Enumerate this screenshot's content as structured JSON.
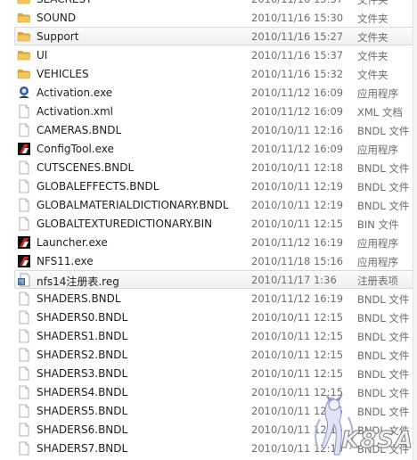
{
  "colors": {
    "folder": "#e8b84a",
    "selection": "#f0f0f0",
    "text": "#1e1e1e",
    "subtle_text": "#6d6d6d",
    "nfs_icon_red": "#d42020"
  },
  "files": [
    {
      "name": "SEACREST",
      "date": "2010/11/16 15:37",
      "type": "文件夹",
      "icon": "folder-icon"
    },
    {
      "name": "SOUND",
      "date": "2010/11/16 15:30",
      "type": "文件夹",
      "icon": "folder-icon"
    },
    {
      "name": "Support",
      "date": "2010/11/16 15:27",
      "type": "文件夹",
      "icon": "folder-icon",
      "selected": true
    },
    {
      "name": "UI",
      "date": "2010/11/16 15:37",
      "type": "文件夹",
      "icon": "folder-icon"
    },
    {
      "name": "VEHICLES",
      "date": "2010/11/16 15:32",
      "type": "文件夹",
      "icon": "folder-icon"
    },
    {
      "name": "Activation.exe",
      "date": "2010/11/12 16:09",
      "type": "应用程序",
      "icon": "activation-exe-icon"
    },
    {
      "name": "Activation.xml",
      "date": "2010/11/12 16:09",
      "type": "XML 文档",
      "icon": "document-icon"
    },
    {
      "name": "CAMERAS.BNDL",
      "date": "2010/10/11 12:16",
      "type": "BNDL 文件",
      "icon": "document-icon"
    },
    {
      "name": "ConfigTool.exe",
      "date": "2010/11/12 16:09",
      "type": "应用程序",
      "icon": "nfs-exe-icon"
    },
    {
      "name": "CUTSCENES.BNDL",
      "date": "2010/10/11 12:18",
      "type": "BNDL 文件",
      "icon": "document-icon"
    },
    {
      "name": "GLOBALEFFECTS.BNDL",
      "date": "2010/10/11 12:19",
      "type": "BNDL 文件",
      "icon": "document-icon"
    },
    {
      "name": "GLOBALMATERIALDICTIONARY.BNDL",
      "date": "2010/10/11 12:19",
      "type": "BNDL 文件",
      "icon": "document-icon"
    },
    {
      "name": "GLOBALTEXTUREDICTIONARY.BIN",
      "date": "2010/10/11 12:15",
      "type": "BIN 文件",
      "icon": "document-icon"
    },
    {
      "name": "Launcher.exe",
      "date": "2010/11/12 16:19",
      "type": "应用程序",
      "icon": "nfs-exe-icon"
    },
    {
      "name": "NFS11.exe",
      "date": "2010/11/18 15:16",
      "type": "应用程序",
      "icon": "nfs-exe-icon"
    },
    {
      "name": "nfs14注册表.reg",
      "date": "2010/11/17 1:36",
      "type": "注册表项",
      "icon": "registry-file-icon",
      "selected": true
    },
    {
      "name": "SHADERS.BNDL",
      "date": "2010/11/12 16:19",
      "type": "BNDL 文件",
      "icon": "document-icon"
    },
    {
      "name": "SHADERS0.BNDL",
      "date": "2010/10/11 12:15",
      "type": "BNDL 文件",
      "icon": "document-icon"
    },
    {
      "name": "SHADERS1.BNDL",
      "date": "2010/10/11 12:15",
      "type": "BNDL 文件",
      "icon": "document-icon"
    },
    {
      "name": "SHADERS2.BNDL",
      "date": "2010/10/11 12:15",
      "type": "BNDL 文件",
      "icon": "document-icon"
    },
    {
      "name": "SHADERS3.BNDL",
      "date": "2010/10/11 12:15",
      "type": "BNDL 文件",
      "icon": "document-icon"
    },
    {
      "name": "SHADERS4.BNDL",
      "date": "2010/10/11 12:15",
      "type": "BNDL 文件",
      "icon": "document-icon"
    },
    {
      "name": "SHADERS5.BNDL",
      "date": "2010/10/11 12:15",
      "type": "BNDL 文件",
      "icon": "document-icon"
    },
    {
      "name": "SHADERS6.BNDL",
      "date": "2010/10/11 12:15",
      "type": "BNDL 文件",
      "icon": "document-icon"
    },
    {
      "name": "SHADERS7.BNDL",
      "date": "2010/10/11 12:15",
      "type": "BNDL 文件",
      "icon": "document-icon"
    }
  ],
  "watermark": {
    "text": "K8SA",
    "icon": "anime-mascot-watermark-icon"
  }
}
